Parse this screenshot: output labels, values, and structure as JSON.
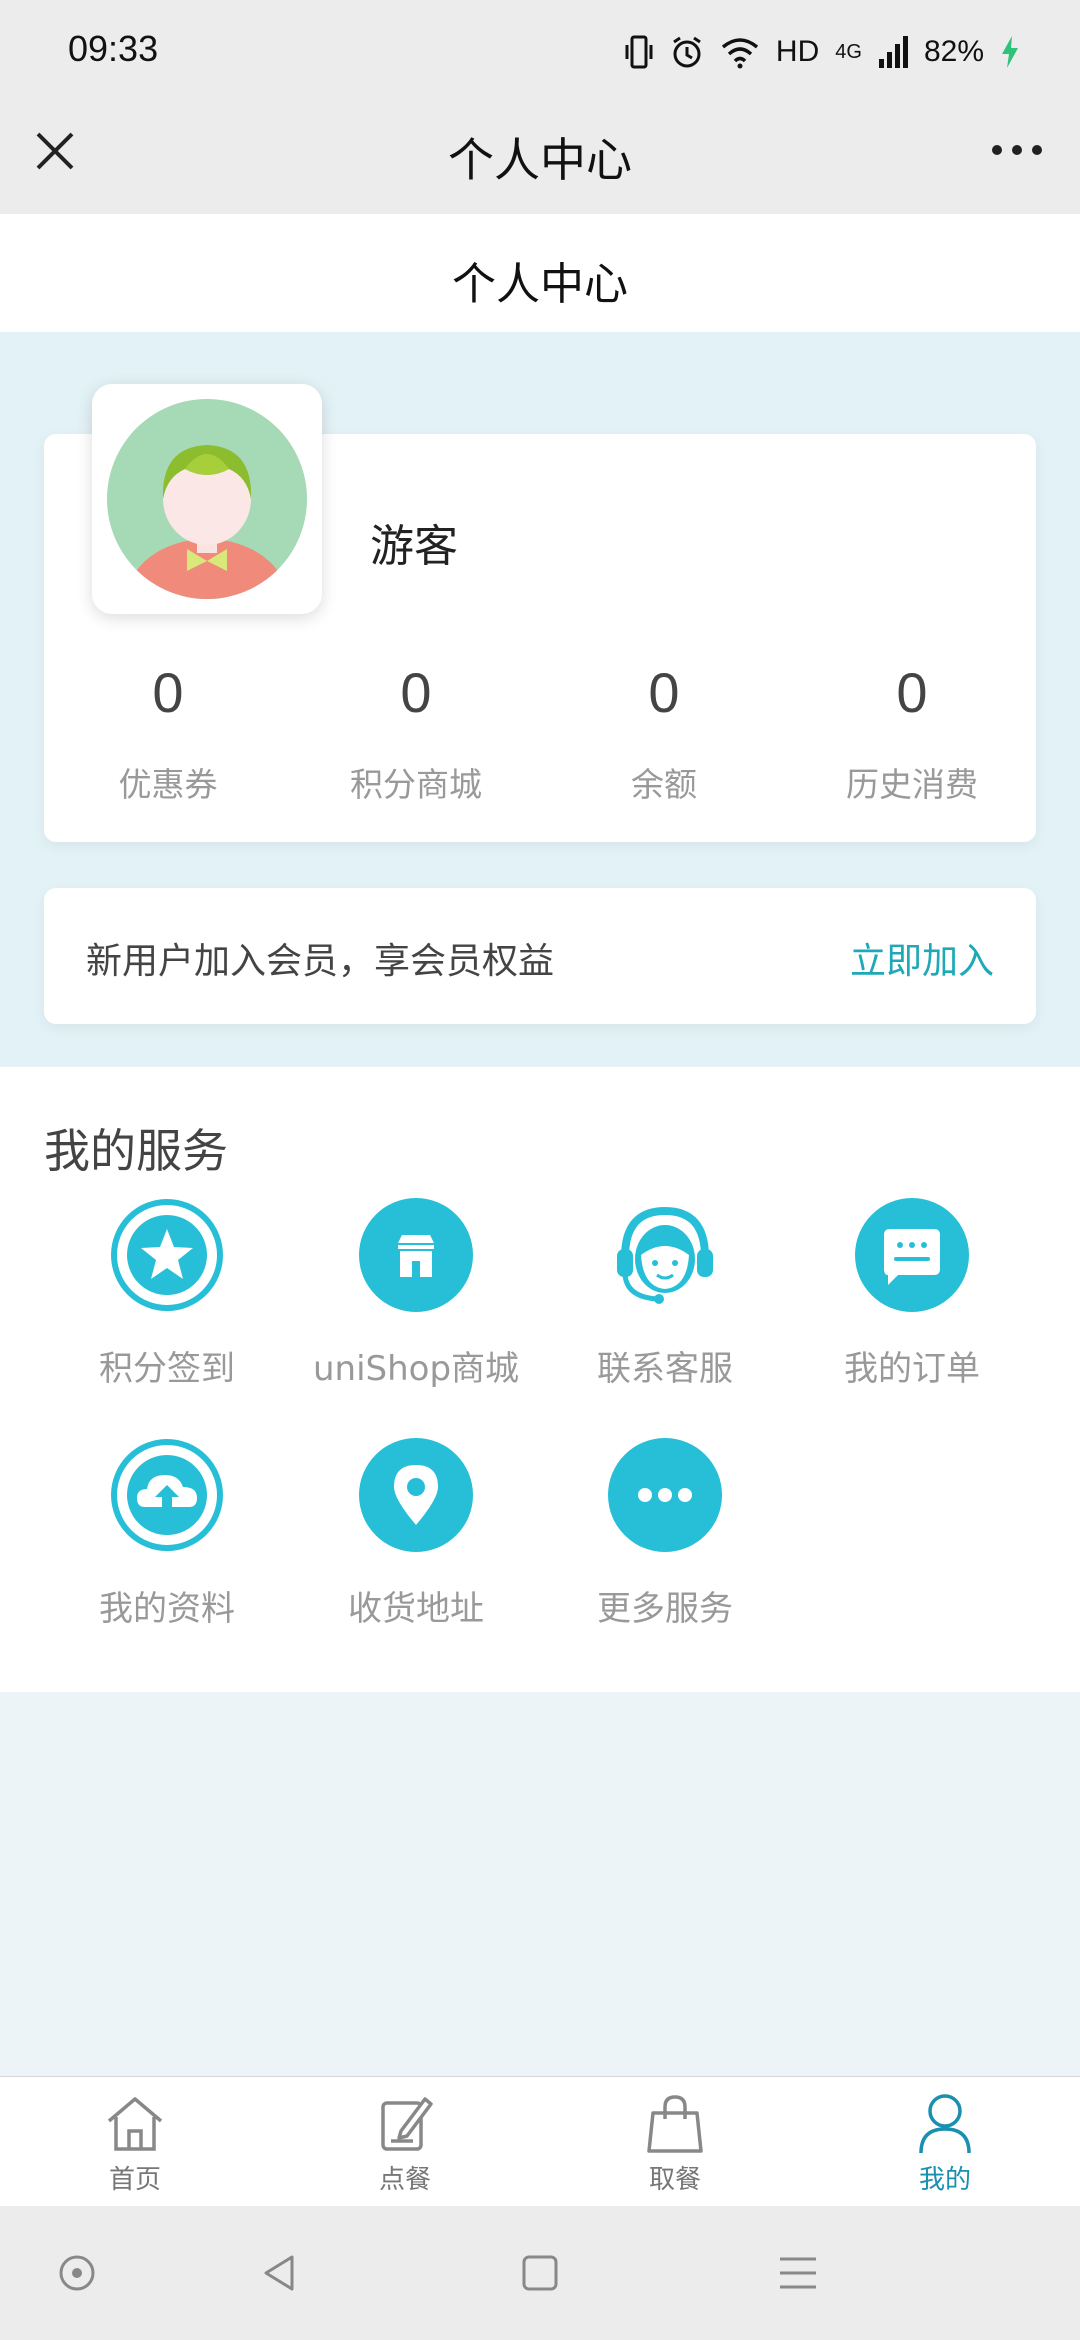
{
  "status_bar": {
    "time": "09:33",
    "hd": "HD",
    "network": "4G",
    "battery": "82%"
  },
  "mp_nav": {
    "title": "个人中心"
  },
  "page": {
    "title": "个人中心"
  },
  "profile": {
    "name": "游客",
    "stats": [
      {
        "value": "0",
        "label": "优惠券"
      },
      {
        "value": "0",
        "label": "积分商城"
      },
      {
        "value": "0",
        "label": "余额"
      },
      {
        "value": "0",
        "label": "历史消费"
      }
    ]
  },
  "member": {
    "text": "新用户加入会员，享会员权益",
    "action": "立即加入"
  },
  "services": {
    "title": "我的服务",
    "items": [
      {
        "label": "积分签到",
        "icon": "star-icon"
      },
      {
        "label": "uniShop商城",
        "icon": "shop-icon"
      },
      {
        "label": "联系客服",
        "icon": "customer-service-icon"
      },
      {
        "label": "我的订单",
        "icon": "chat-order-icon"
      },
      {
        "label": "我的资料",
        "icon": "cloud-upload-icon"
      },
      {
        "label": "收货地址",
        "icon": "location-pin-icon"
      },
      {
        "label": "更多服务",
        "icon": "more-dots-icon"
      }
    ]
  },
  "tabbar": {
    "items": [
      {
        "label": "首页",
        "icon": "home-icon"
      },
      {
        "label": "点餐",
        "icon": "edit-icon"
      },
      {
        "label": "取餐",
        "icon": "bag-icon"
      },
      {
        "label": "我的",
        "icon": "user-icon"
      }
    ],
    "active_index": 3
  },
  "colors": {
    "accent": "#27bfd8",
    "link": "#1fa8b8",
    "tab_active": "#1a8fb0"
  }
}
